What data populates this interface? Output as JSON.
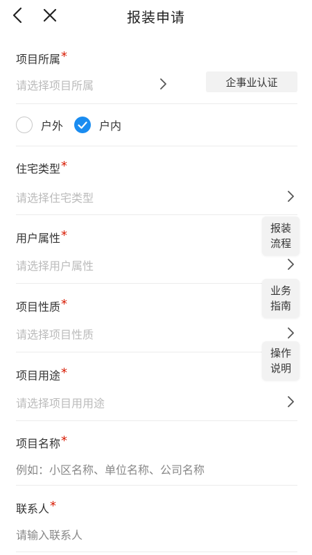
{
  "header": {
    "title": "报装申请",
    "back_icon": "chevron-left-icon",
    "close_icon": "close-icon"
  },
  "form": {
    "project_affiliation": {
      "label": "项目所属",
      "required_mark": "*",
      "placeholder": "请选择项目所属",
      "cert_button": "企事业认证"
    },
    "location": {
      "options": [
        {
          "label": "户外",
          "checked": false
        },
        {
          "label": "户内",
          "checked": true
        }
      ]
    },
    "residence_type": {
      "label": "住宅类型",
      "required_mark": "*",
      "placeholder": "请选择住宅类型"
    },
    "user_attribute": {
      "label": "用户属性",
      "required_mark": "*",
      "placeholder": "请选择用户属性"
    },
    "project_nature": {
      "label": "项目性质",
      "required_mark": "*",
      "placeholder": "请选择项目性质"
    },
    "project_usage": {
      "label": "项目用途",
      "required_mark": "*",
      "placeholder": "请选择项目用用途"
    },
    "project_name": {
      "label": "项目名称",
      "required_mark": "*",
      "placeholder": "例如：小区名称、单位名称、公司名称"
    },
    "contact": {
      "label": "联系人",
      "required_mark": "*",
      "placeholder": "请输入联系人"
    }
  },
  "side_buttons": [
    {
      "line1": "报装",
      "line2": "流程"
    },
    {
      "line1": "业务",
      "line2": "指南"
    },
    {
      "line1": "操作",
      "line2": "说明"
    }
  ],
  "colors": {
    "accent": "#1a8cf0",
    "required": "#d81e06",
    "placeholder": "#bbbbbb",
    "divider": "#ebebeb"
  }
}
